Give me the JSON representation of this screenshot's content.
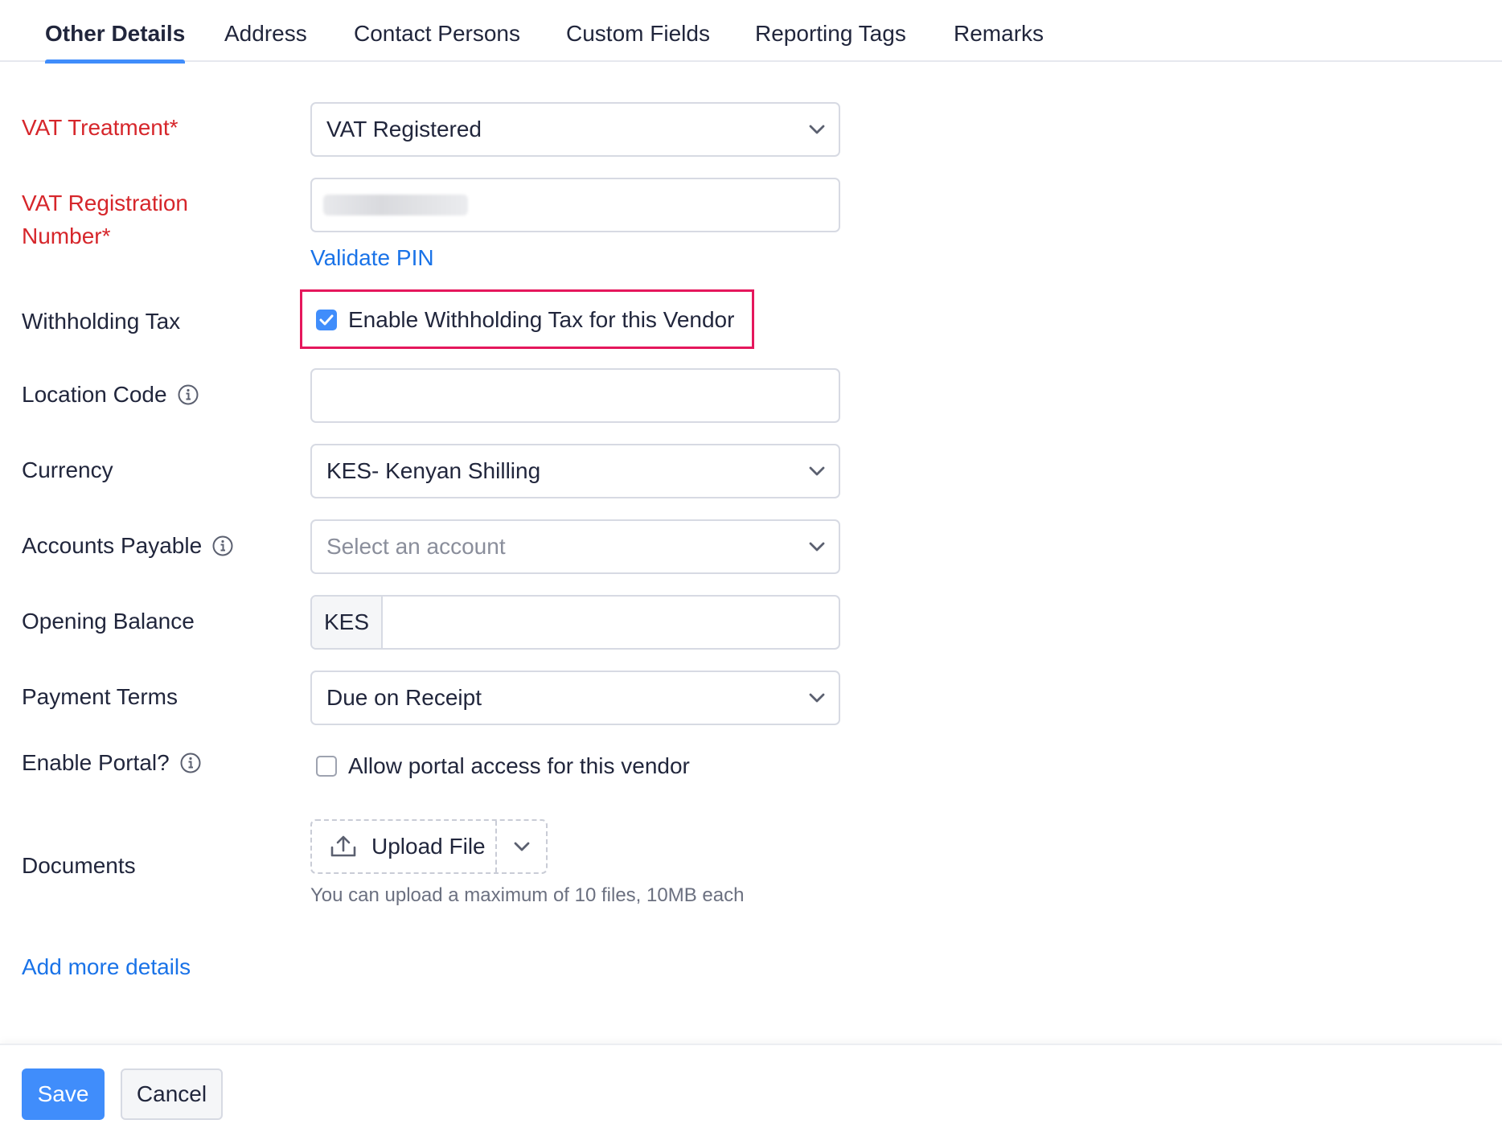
{
  "tabs": [
    {
      "label": "Other Details",
      "active": true
    },
    {
      "label": "Address"
    },
    {
      "label": "Contact Persons"
    },
    {
      "label": "Custom Fields"
    },
    {
      "label": "Reporting Tags"
    },
    {
      "label": "Remarks"
    }
  ],
  "form": {
    "vat_treatment": {
      "label": "VAT Treatment*",
      "value": "VAT Registered"
    },
    "vat_reg": {
      "label_line1": "VAT Registration",
      "label_line2": "Number*",
      "value": "",
      "validate_link": "Validate PIN"
    },
    "withholding": {
      "label": "Withholding Tax",
      "checkbox_label": "Enable Withholding Tax for this Vendor",
      "checked": true
    },
    "location_code": {
      "label": "Location Code",
      "value": ""
    },
    "currency": {
      "label": "Currency",
      "value": "KES- Kenyan Shilling"
    },
    "accounts_payable": {
      "label": "Accounts Payable",
      "placeholder": "Select an account"
    },
    "opening_balance": {
      "label": "Opening Balance",
      "prefix": "KES",
      "value": ""
    },
    "payment_terms": {
      "label": "Payment Terms",
      "value": "Due on Receipt"
    },
    "portal": {
      "label": "Enable Portal?",
      "checkbox_label": "Allow portal access for this vendor",
      "checked": false
    },
    "documents": {
      "label": "Documents",
      "upload_label": "Upload File",
      "hint": "You can upload a maximum of 10 files, 10MB each"
    },
    "add_more": "Add more details"
  },
  "footer": {
    "save": "Save",
    "cancel": "Cancel"
  },
  "colors": {
    "accent": "#408dfb",
    "required": "#d6262b",
    "link": "#1a73e8",
    "highlight": "#e5175c"
  }
}
